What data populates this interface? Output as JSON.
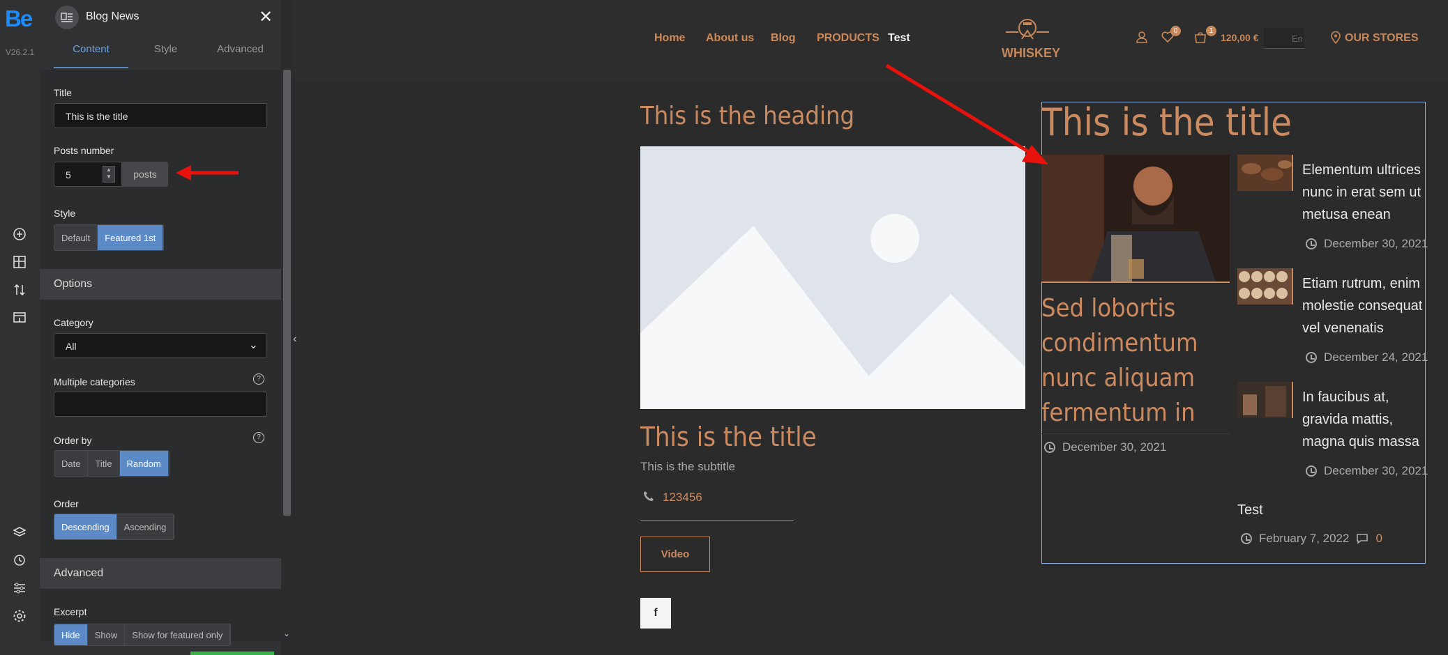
{
  "toolbar": {
    "logo": "Be",
    "version": "V26.2.1"
  },
  "panel": {
    "title": "Blog News",
    "tabs": [
      "Content",
      "Style",
      "Advanced"
    ],
    "title_label": "Title",
    "title_value": "This is the title",
    "posts_label": "Posts number",
    "posts_value": "5",
    "posts_unit": "posts",
    "style_label": "Style",
    "style_options": [
      "Default",
      "Featured 1st"
    ],
    "options_section": "Options",
    "category_label": "Category",
    "category_value": "All",
    "multi_label": "Multiple categories",
    "orderby_label": "Order by",
    "orderby_options": [
      "Date",
      "Title",
      "Random"
    ],
    "order_label": "Order",
    "order_options": [
      "Descending",
      "Ascending"
    ],
    "advanced_section": "Advanced",
    "excerpt_label": "Excerpt",
    "excerpt_options": [
      "Hide",
      "Show",
      "Show for featured only"
    ]
  },
  "site": {
    "nav": [
      "Home",
      "About us",
      "Blog",
      "PRODUCTS",
      "Test"
    ],
    "brand": "WHISKEY",
    "wishlist_count": "0",
    "cart_count": "1",
    "cart_total": "120,00 €",
    "lang": "En",
    "stores": "OUR STORES",
    "heading": "This is the heading",
    "left_title": "This is the title",
    "left_subtitle": "This is the subtitle",
    "phone": "123456",
    "video_btn": "Video",
    "fb": "f",
    "blog_title": "This is the title",
    "featured_title": "Sed lobortis condimentum nunc aliquam fermentum in",
    "featured_date": "December 30, 2021",
    "posts": [
      {
        "title": "Elementum ultrices nunc in erat sem ut metusa enean",
        "date": "December 30, 2021"
      },
      {
        "title": "Etiam rutrum, enim molestie consequat vel venenatis",
        "date": "December 24, 2021"
      },
      {
        "title": "In faucibus at, gravida mattis, magna quis massa",
        "date": "December 30, 2021"
      }
    ],
    "last_title": "Test",
    "last_date": "February 7, 2022",
    "last_comments": "0"
  }
}
